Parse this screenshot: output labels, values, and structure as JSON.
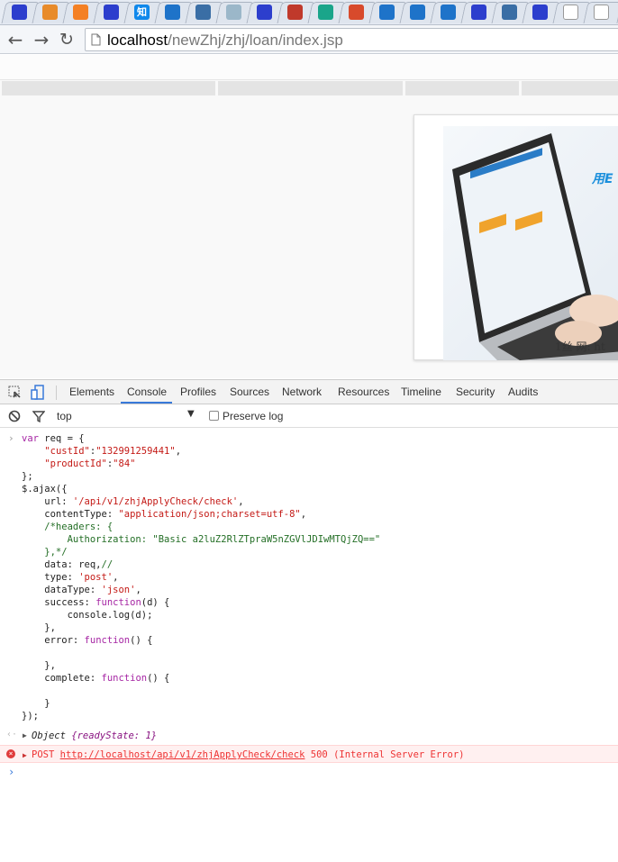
{
  "browser": {
    "tabs": [
      {
        "icon": "baidu-paw-icon",
        "color": "#2c3ecd"
      },
      {
        "icon": "flower-icon",
        "color": "#e88b2a"
      },
      {
        "icon": "stackoverflow-icon",
        "color": "#f48024"
      },
      {
        "icon": "baidu-paw-icon",
        "color": "#2c3ecd"
      },
      {
        "icon": "zhihu-icon",
        "color": "#0f88eb",
        "glyph": "知"
      },
      {
        "icon": "circle-app-icon",
        "color": "#1e73c9"
      },
      {
        "icon": "c-app-icon",
        "color": "#3a6ea5"
      },
      {
        "icon": "w-app-icon",
        "color": "#9bb7c9"
      },
      {
        "icon": "baidu-paw-icon",
        "color": "#2c3ecd"
      },
      {
        "icon": "b-app-icon",
        "color": "#c0392b"
      },
      {
        "icon": "z-app-icon",
        "color": "#1aa58a"
      },
      {
        "icon": "colorful-app-icon",
        "color": "#d84a2c"
      },
      {
        "icon": "circle-app-icon",
        "color": "#1e73c9"
      },
      {
        "icon": "circle-app-icon",
        "color": "#1e73c9"
      },
      {
        "icon": "circle-app-icon",
        "color": "#1e73c9"
      },
      {
        "icon": "baidu-paw-icon",
        "color": "#2c3ecd"
      },
      {
        "icon": "c-app-icon",
        "color": "#3a6ea5"
      },
      {
        "icon": "baidu-paw-icon",
        "color": "#2c3ecd"
      },
      {
        "icon": "page-icon",
        "color": "#ffffff"
      },
      {
        "icon": "page-icon",
        "color": "#ffffff"
      }
    ],
    "url_host": "localhost",
    "url_path": "/newZhj/zhj/loan/index.jsp"
  },
  "page": {
    "banner_text": "用E",
    "watermark": "1丝   网: ht"
  },
  "devtools": {
    "tabs": [
      "Elements",
      "Console",
      "Profiles",
      "Sources",
      "Network",
      "Resources",
      "Timeline",
      "Security",
      "Audits"
    ],
    "selected_tab": "Console",
    "context": "top",
    "preserve_log": "Preserve log",
    "console_lines": [
      "var req = {",
      "    \"custId\":\"132991259441\",",
      "    \"productId\":\"84\"",
      "};",
      "$.ajax({",
      "    url: '/api/v1/zhjApplyCheck/check',",
      "    contentType: \"application/json;charset=utf-8\",",
      "    /*headers: {",
      "        Authorization: \"Basic a2luZ2RlZTpraW5nZGVlJDIwMTQjZQ==\"",
      "    },*/",
      "    data: req,//",
      "    type: 'post',",
      "    dataType: 'json',",
      "    success: function(d) {",
      "        console.log(d);",
      "    },",
      "    error: function() {",
      "",
      "    },",
      "    complete: function() {",
      "",
      "    }",
      "});"
    ],
    "result": {
      "prefix": "Object",
      "body": "{readyState: 1}"
    },
    "error": {
      "method": "POST",
      "url": "http://localhost/api/v1/zhjApplyCheck/check",
      "status": "500 (Internal Server Error)"
    }
  }
}
